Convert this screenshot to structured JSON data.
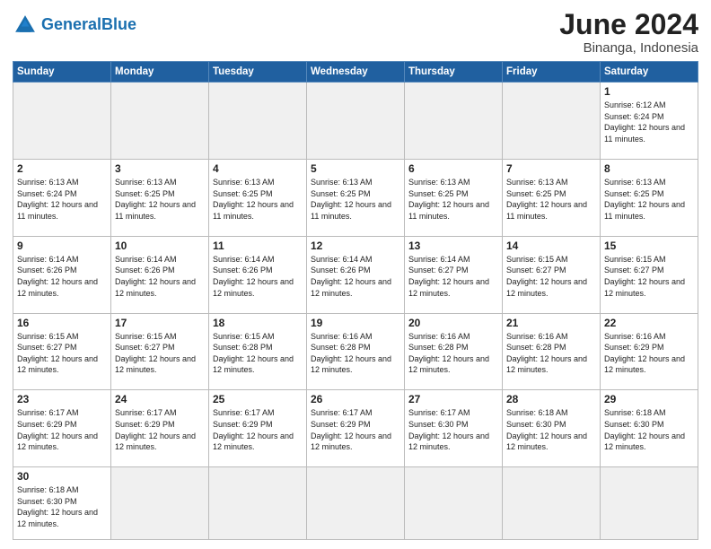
{
  "header": {
    "logo_general": "General",
    "logo_blue": "Blue",
    "title": "June 2024",
    "subtitle": "Binanga, Indonesia"
  },
  "weekdays": [
    "Sunday",
    "Monday",
    "Tuesday",
    "Wednesday",
    "Thursday",
    "Friday",
    "Saturday"
  ],
  "weeks": [
    [
      {
        "day": "",
        "info": ""
      },
      {
        "day": "",
        "info": ""
      },
      {
        "day": "",
        "info": ""
      },
      {
        "day": "",
        "info": ""
      },
      {
        "day": "",
        "info": ""
      },
      {
        "day": "",
        "info": ""
      },
      {
        "day": "1",
        "info": "Sunrise: 6:12 AM\nSunset: 6:24 PM\nDaylight: 12 hours and 11 minutes."
      }
    ],
    [
      {
        "day": "2",
        "info": "Sunrise: 6:13 AM\nSunset: 6:24 PM\nDaylight: 12 hours and 11 minutes."
      },
      {
        "day": "3",
        "info": "Sunrise: 6:13 AM\nSunset: 6:25 PM\nDaylight: 12 hours and 11 minutes."
      },
      {
        "day": "4",
        "info": "Sunrise: 6:13 AM\nSunset: 6:25 PM\nDaylight: 12 hours and 11 minutes."
      },
      {
        "day": "5",
        "info": "Sunrise: 6:13 AM\nSunset: 6:25 PM\nDaylight: 12 hours and 11 minutes."
      },
      {
        "day": "6",
        "info": "Sunrise: 6:13 AM\nSunset: 6:25 PM\nDaylight: 12 hours and 11 minutes."
      },
      {
        "day": "7",
        "info": "Sunrise: 6:13 AM\nSunset: 6:25 PM\nDaylight: 12 hours and 11 minutes."
      },
      {
        "day": "8",
        "info": "Sunrise: 6:13 AM\nSunset: 6:25 PM\nDaylight: 12 hours and 11 minutes."
      }
    ],
    [
      {
        "day": "9",
        "info": "Sunrise: 6:14 AM\nSunset: 6:26 PM\nDaylight: 12 hours and 12 minutes."
      },
      {
        "day": "10",
        "info": "Sunrise: 6:14 AM\nSunset: 6:26 PM\nDaylight: 12 hours and 12 minutes."
      },
      {
        "day": "11",
        "info": "Sunrise: 6:14 AM\nSunset: 6:26 PM\nDaylight: 12 hours and 12 minutes."
      },
      {
        "day": "12",
        "info": "Sunrise: 6:14 AM\nSunset: 6:26 PM\nDaylight: 12 hours and 12 minutes."
      },
      {
        "day": "13",
        "info": "Sunrise: 6:14 AM\nSunset: 6:27 PM\nDaylight: 12 hours and 12 minutes."
      },
      {
        "day": "14",
        "info": "Sunrise: 6:15 AM\nSunset: 6:27 PM\nDaylight: 12 hours and 12 minutes."
      },
      {
        "day": "15",
        "info": "Sunrise: 6:15 AM\nSunset: 6:27 PM\nDaylight: 12 hours and 12 minutes."
      }
    ],
    [
      {
        "day": "16",
        "info": "Sunrise: 6:15 AM\nSunset: 6:27 PM\nDaylight: 12 hours and 12 minutes."
      },
      {
        "day": "17",
        "info": "Sunrise: 6:15 AM\nSunset: 6:27 PM\nDaylight: 12 hours and 12 minutes."
      },
      {
        "day": "18",
        "info": "Sunrise: 6:15 AM\nSunset: 6:28 PM\nDaylight: 12 hours and 12 minutes."
      },
      {
        "day": "19",
        "info": "Sunrise: 6:16 AM\nSunset: 6:28 PM\nDaylight: 12 hours and 12 minutes."
      },
      {
        "day": "20",
        "info": "Sunrise: 6:16 AM\nSunset: 6:28 PM\nDaylight: 12 hours and 12 minutes."
      },
      {
        "day": "21",
        "info": "Sunrise: 6:16 AM\nSunset: 6:28 PM\nDaylight: 12 hours and 12 minutes."
      },
      {
        "day": "22",
        "info": "Sunrise: 6:16 AM\nSunset: 6:29 PM\nDaylight: 12 hours and 12 minutes."
      }
    ],
    [
      {
        "day": "23",
        "info": "Sunrise: 6:17 AM\nSunset: 6:29 PM\nDaylight: 12 hours and 12 minutes."
      },
      {
        "day": "24",
        "info": "Sunrise: 6:17 AM\nSunset: 6:29 PM\nDaylight: 12 hours and 12 minutes."
      },
      {
        "day": "25",
        "info": "Sunrise: 6:17 AM\nSunset: 6:29 PM\nDaylight: 12 hours and 12 minutes."
      },
      {
        "day": "26",
        "info": "Sunrise: 6:17 AM\nSunset: 6:29 PM\nDaylight: 12 hours and 12 minutes."
      },
      {
        "day": "27",
        "info": "Sunrise: 6:17 AM\nSunset: 6:30 PM\nDaylight: 12 hours and 12 minutes."
      },
      {
        "day": "28",
        "info": "Sunrise: 6:18 AM\nSunset: 6:30 PM\nDaylight: 12 hours and 12 minutes."
      },
      {
        "day": "29",
        "info": "Sunrise: 6:18 AM\nSunset: 6:30 PM\nDaylight: 12 hours and 12 minutes."
      }
    ],
    [
      {
        "day": "30",
        "info": "Sunrise: 6:18 AM\nSunset: 6:30 PM\nDaylight: 12 hours and 12 minutes."
      },
      {
        "day": "",
        "info": ""
      },
      {
        "day": "",
        "info": ""
      },
      {
        "day": "",
        "info": ""
      },
      {
        "day": "",
        "info": ""
      },
      {
        "day": "",
        "info": ""
      },
      {
        "day": "",
        "info": ""
      }
    ]
  ]
}
